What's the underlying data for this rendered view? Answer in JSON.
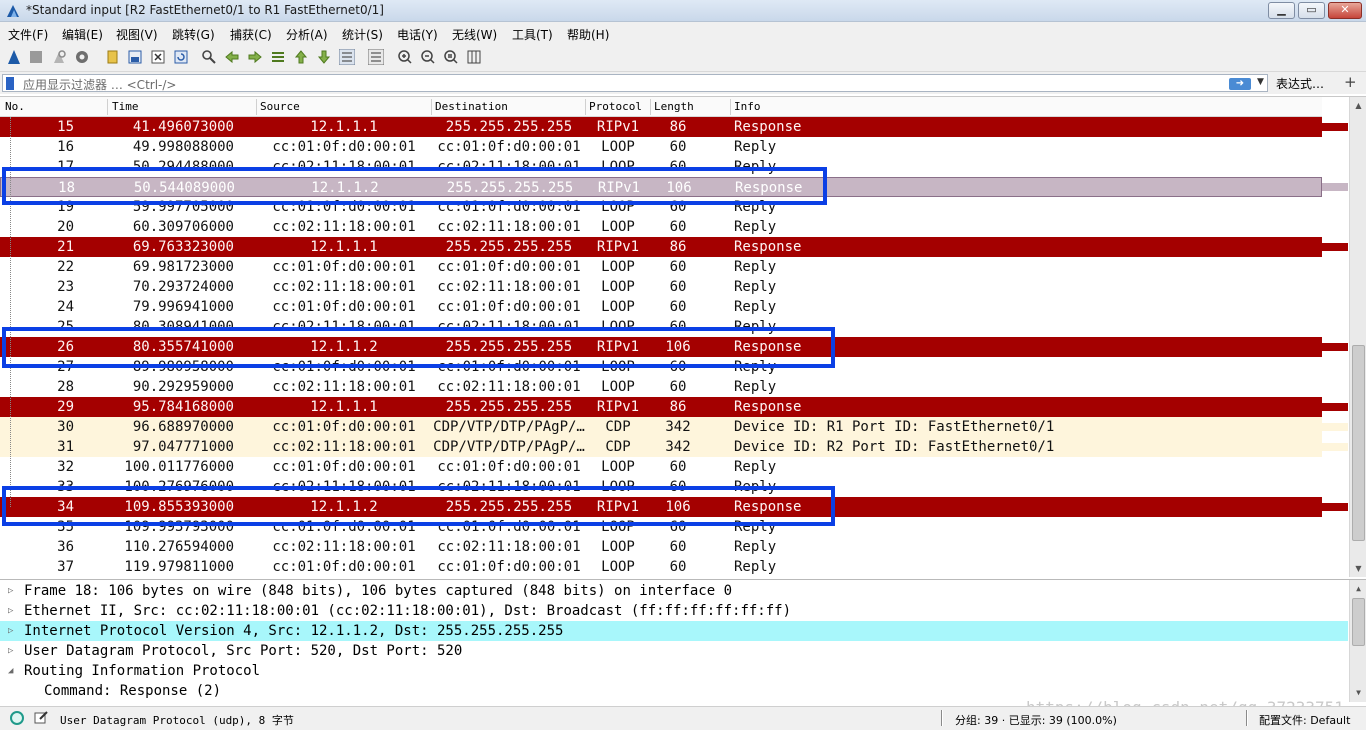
{
  "window": {
    "title": "*Standard input [R2 FastEthernet0/1 to R1 FastEthernet0/1]"
  },
  "menu": [
    "文件(F)",
    "编辑(E)",
    "视图(V)",
    "跳转(G)",
    "捕获(C)",
    "分析(A)",
    "统计(S)",
    "电话(Y)",
    "无线(W)",
    "工具(T)",
    "帮助(H)"
  ],
  "filter": {
    "placeholder": "应用显示过滤器 … <Ctrl-/>",
    "expression_label": "表达式…",
    "add_label": "+"
  },
  "columns": {
    "no": "No.",
    "time": "Time",
    "source": "Source",
    "destination": "Destination",
    "protocol": "Protocol",
    "length": "Length",
    "info": "Info"
  },
  "packets": [
    {
      "no": "15",
      "time": "41.496073000",
      "src": "12.1.1.1",
      "dst": "255.255.255.255",
      "proto": "RIPv1",
      "len": "86",
      "info": "Response",
      "style": "rip"
    },
    {
      "no": "16",
      "time": "49.998088000",
      "src": "cc:01:0f:d0:00:01",
      "dst": "cc:01:0f:d0:00:01",
      "proto": "LOOP",
      "len": "60",
      "info": "Reply",
      "style": "plain"
    },
    {
      "no": "17",
      "time": "50.294488000",
      "src": "cc:02:11:18:00:01",
      "dst": "cc:02:11:18:00:01",
      "proto": "LOOP",
      "len": "60",
      "info": "Reply",
      "style": "plain"
    },
    {
      "no": "18",
      "time": "50.544089000",
      "src": "12.1.1.2",
      "dst": "255.255.255.255",
      "proto": "RIPv1",
      "len": "106",
      "info": "Response",
      "style": "selected"
    },
    {
      "no": "19",
      "time": "59.997705000",
      "src": "cc:01:0f:d0:00:01",
      "dst": "cc:01:0f:d0:00:01",
      "proto": "LOOP",
      "len": "60",
      "info": "Reply",
      "style": "plain"
    },
    {
      "no": "20",
      "time": "60.309706000",
      "src": "cc:02:11:18:00:01",
      "dst": "cc:02:11:18:00:01",
      "proto": "LOOP",
      "len": "60",
      "info": "Reply",
      "style": "plain"
    },
    {
      "no": "21",
      "time": "69.763323000",
      "src": "12.1.1.1",
      "dst": "255.255.255.255",
      "proto": "RIPv1",
      "len": "86",
      "info": "Response",
      "style": "rip"
    },
    {
      "no": "22",
      "time": "69.981723000",
      "src": "cc:01:0f:d0:00:01",
      "dst": "cc:01:0f:d0:00:01",
      "proto": "LOOP",
      "len": "60",
      "info": "Reply",
      "style": "plain"
    },
    {
      "no": "23",
      "time": "70.293724000",
      "src": "cc:02:11:18:00:01",
      "dst": "cc:02:11:18:00:01",
      "proto": "LOOP",
      "len": "60",
      "info": "Reply",
      "style": "plain"
    },
    {
      "no": "24",
      "time": "79.996941000",
      "src": "cc:01:0f:d0:00:01",
      "dst": "cc:01:0f:d0:00:01",
      "proto": "LOOP",
      "len": "60",
      "info": "Reply",
      "style": "plain"
    },
    {
      "no": "25",
      "time": "80.308941000",
      "src": "cc:02:11:18:00:01",
      "dst": "cc:02:11:18:00:01",
      "proto": "LOOP",
      "len": "60",
      "info": "Reply",
      "style": "plain"
    },
    {
      "no": "26",
      "time": "80.355741000",
      "src": "12.1.1.2",
      "dst": "255.255.255.255",
      "proto": "RIPv1",
      "len": "106",
      "info": "Response",
      "style": "rip"
    },
    {
      "no": "27",
      "time": "89.980958000",
      "src": "cc:01:0f:d0:00:01",
      "dst": "cc:01:0f:d0:00:01",
      "proto": "LOOP",
      "len": "60",
      "info": "Reply",
      "style": "plain"
    },
    {
      "no": "28",
      "time": "90.292959000",
      "src": "cc:02:11:18:00:01",
      "dst": "cc:02:11:18:00:01",
      "proto": "LOOP",
      "len": "60",
      "info": "Reply",
      "style": "plain"
    },
    {
      "no": "29",
      "time": "95.784168000",
      "src": "12.1.1.1",
      "dst": "255.255.255.255",
      "proto": "RIPv1",
      "len": "86",
      "info": "Response",
      "style": "rip"
    },
    {
      "no": "30",
      "time": "96.688970000",
      "src": "cc:01:0f:d0:00:01",
      "dst": "CDP/VTP/DTP/PAgP/…",
      "proto": "CDP",
      "len": "342",
      "info": "Device ID: R1  Port ID: FastEthernet0/1",
      "style": "cdp"
    },
    {
      "no": "31",
      "time": "97.047771000",
      "src": "cc:02:11:18:00:01",
      "dst": "CDP/VTP/DTP/PAgP/…",
      "proto": "CDP",
      "len": "342",
      "info": "Device ID: R2  Port ID: FastEthernet0/1",
      "style": "cdp"
    },
    {
      "no": "32",
      "time": "100.011776000",
      "src": "cc:01:0f:d0:00:01",
      "dst": "cc:01:0f:d0:00:01",
      "proto": "LOOP",
      "len": "60",
      "info": "Reply",
      "style": "plain"
    },
    {
      "no": "33",
      "time": "100.276976000",
      "src": "cc:02:11:18:00:01",
      "dst": "cc:02:11:18:00:01",
      "proto": "LOOP",
      "len": "60",
      "info": "Reply",
      "style": "plain"
    },
    {
      "no": "34",
      "time": "109.855393000",
      "src": "12.1.1.2",
      "dst": "255.255.255.255",
      "proto": "RIPv1",
      "len": "106",
      "info": "Response",
      "style": "rip"
    },
    {
      "no": "35",
      "time": "109.993793000",
      "src": "cc:01:0f:d0:00:01",
      "dst": "cc:01:0f:d0:00:01",
      "proto": "LOOP",
      "len": "60",
      "info": "Reply",
      "style": "plain"
    },
    {
      "no": "36",
      "time": "110.276594000",
      "src": "cc:02:11:18:00:01",
      "dst": "cc:02:11:18:00:01",
      "proto": "LOOP",
      "len": "60",
      "info": "Reply",
      "style": "plain"
    },
    {
      "no": "37",
      "time": "119.979811000",
      "src": "cc:01:0f:d0:00:01",
      "dst": "cc:01:0f:d0:00:01",
      "proto": "LOOP",
      "len": "60",
      "info": "Reply",
      "style": "plain"
    }
  ],
  "details": [
    {
      "text": "Frame 18: 106 bytes on wire (848 bits), 106 bytes captured (848 bits) on interface 0",
      "twisty": "▷",
      "highlight": false
    },
    {
      "text": "Ethernet II, Src: cc:02:11:18:00:01 (cc:02:11:18:00:01), Dst: Broadcast (ff:ff:ff:ff:ff:ff)",
      "twisty": "▷",
      "highlight": false
    },
    {
      "text": "Internet Protocol Version 4, Src: 12.1.1.2, Dst: 255.255.255.255",
      "twisty": "▷",
      "highlight": true
    },
    {
      "text": "User Datagram Protocol, Src Port: 520, Dst Port: 520",
      "twisty": "▷",
      "highlight": false
    },
    {
      "text": "Routing Information Protocol",
      "twisty": "◢",
      "highlight": false
    },
    {
      "text": "Command: Response (2)",
      "twisty": "",
      "highlight": false,
      "child": true
    }
  ],
  "status": {
    "field_text": "User Datagram Protocol (udp), 8 字节",
    "packets": "分组: 39 · 已显示: 39 (100.0%)",
    "profile": "配置文件: Default"
  },
  "watermark": "https://blog.csdn.net/qq_37233751",
  "colors": {
    "rip_row": "#a40000",
    "cdp_row": "#fef5dc",
    "selected_row": "#c7b6c4",
    "detail_highlight": "#a8f7fb",
    "annotation": "#0b3fe5"
  },
  "icons": [
    "wireshark-fin-icon",
    "start-capture-icon",
    "stop-capture-icon",
    "restart-capture-icon",
    "options-gear-icon",
    "open-folder-icon",
    "save-file-icon",
    "close-file-icon",
    "reload-icon",
    "find-packet-icon",
    "go-back-icon",
    "go-forward-icon",
    "go-to-packet-icon",
    "first-packet-icon",
    "last-packet-icon",
    "auto-scroll-icon",
    "colorize-icon",
    "zoom-in-icon",
    "zoom-out-icon",
    "zoom-normal-icon",
    "resize-columns-icon"
  ]
}
